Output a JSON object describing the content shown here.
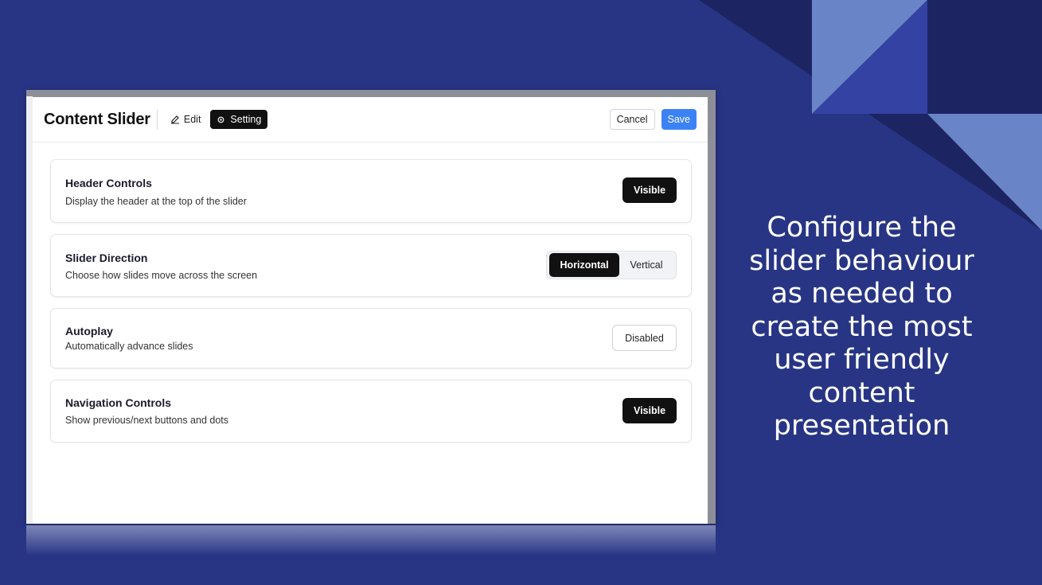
{
  "modal": {
    "title": "Content Slider",
    "tabs": {
      "edit": "Edit",
      "setting": "Setting"
    },
    "actions": {
      "cancel": "Cancel",
      "save": "Save"
    }
  },
  "settings": [
    {
      "title": "Header Controls",
      "description": "Display the header at the top of the slider",
      "value": "Visible"
    },
    {
      "title": "Slider Direction",
      "description": "Choose how slides move across the screen",
      "options": [
        "Horizontal",
        "Vertical"
      ],
      "selected": "Horizontal"
    },
    {
      "title": "Autoplay",
      "description": "Automatically advance slides",
      "value": "Disabled"
    },
    {
      "title": "Navigation Controls",
      "description": "Show previous/next buttons and dots",
      "value": "Visible"
    }
  ],
  "caption": "Configure the slider behaviour as needed to create the most user friendly content presentation",
  "colors": {
    "background": "#283585",
    "accent_light": "#6a84c8",
    "accent_dark": "#1c2562",
    "save_button": "#3b82f6"
  },
  "icons": {
    "edit": "edit-icon",
    "setting": "gear-icon"
  }
}
